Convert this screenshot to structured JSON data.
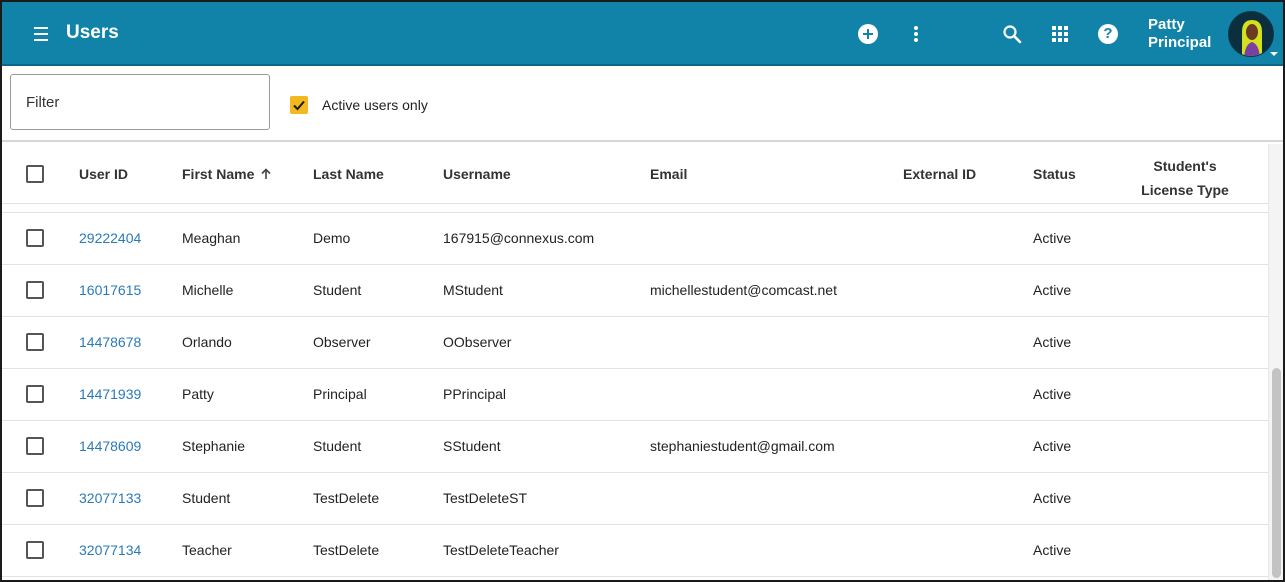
{
  "header": {
    "title": "Users",
    "user_first": "Patty",
    "user_last": "Principal",
    "icons": [
      "menu-icon",
      "add-icon",
      "more-vert-icon",
      "search-icon",
      "apps-icon",
      "help-icon",
      "avatar"
    ],
    "bg_color": "#1283a8"
  },
  "toolbar": {
    "filter_placeholder": "Filter",
    "active_only_label": "Active users only",
    "active_only_checked": true,
    "check_color": "#f3b81d"
  },
  "table": {
    "columns": {
      "user_id": "User ID",
      "first_name": "First Name",
      "last_name": "Last Name",
      "username": "Username",
      "email": "Email",
      "external_id": "External ID",
      "status": "Status",
      "license": "Student's License Type"
    },
    "sorted_by": "first_name",
    "sort_direction": "ascending",
    "rows": [
      {
        "user_id": "29222404",
        "first_name": "Meaghan",
        "last_name": "Demo",
        "username": "167915@connexus.com",
        "email": "",
        "external_id": "",
        "status": "Active",
        "license": ""
      },
      {
        "user_id": "16017615",
        "first_name": "Michelle",
        "last_name": "Student",
        "username": "MStudent",
        "email": "michellestudent@comcast.net",
        "external_id": "",
        "status": "Active",
        "license": ""
      },
      {
        "user_id": "14478678",
        "first_name": "Orlando",
        "last_name": "Observer",
        "username": "OObserver",
        "email": "",
        "external_id": "",
        "status": "Active",
        "license": ""
      },
      {
        "user_id": "14471939",
        "first_name": "Patty",
        "last_name": "Principal",
        "username": "PPrincipal",
        "email": "",
        "external_id": "",
        "status": "Active",
        "license": ""
      },
      {
        "user_id": "14478609",
        "first_name": "Stephanie",
        "last_name": "Student",
        "username": "SStudent",
        "email": "stephaniestudent@gmail.com",
        "external_id": "",
        "status": "Active",
        "license": ""
      },
      {
        "user_id": "32077133",
        "first_name": "Student",
        "last_name": "TestDelete",
        "username": "TestDeleteST",
        "email": "",
        "external_id": "",
        "status": "Active",
        "license": ""
      },
      {
        "user_id": "32077134",
        "first_name": "Teacher",
        "last_name": "TestDelete",
        "username": "TestDeleteTeacher",
        "email": "",
        "external_id": "",
        "status": "Active",
        "license": ""
      }
    ],
    "link_color": "#2a7ab8"
  }
}
